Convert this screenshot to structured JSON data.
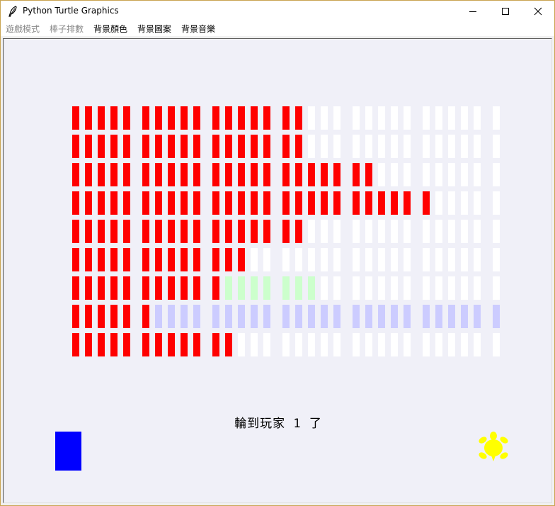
{
  "window": {
    "title": "Python Turtle Graphics",
    "icon": "feather-icon",
    "minimize": "minimize-icon",
    "maximize": "maximize-icon",
    "close": "close-icon"
  },
  "menu": [
    {
      "label": "遊戲模式",
      "enabled": false
    },
    {
      "label": "棒子排數",
      "enabled": false
    },
    {
      "label": "背景顏色",
      "enabled": true
    },
    {
      "label": "背景圖案",
      "enabled": true
    },
    {
      "label": "背景音樂",
      "enabled": true
    }
  ],
  "board": {
    "rows": [
      "RRRRR RRRRR RRRRR RRWWW WWWWW WWWWW W",
      "RRRRR RRRRR RRRRR RRWWW WWWWW WWWWW W",
      "RRRRR RRRRR RRRRR RRRRR RRWWW WWWWW W",
      "RRRRR RRRRR RRRRR RRRRR RRRRR RWWWW W",
      "RRRRR RRRRR RRRRR RRWWW WWWWW WWWWW W",
      "RRRRR RRRRR RRRWW WWWWW WWWWW WWWWW W",
      "RRRRR RRRRR RGGGG GGGWW WWWWW WWWWW W",
      "RRRRR RBBBB BBBBB BBBBB BBBBB BBBBB B",
      "RRRRR RRRRR RRWWW WWWWW WWWWW WWWWW W"
    ],
    "colors": {
      "R": "#ff0000",
      "W": "#ffffff",
      "G": "#ccffcc",
      "B": "#ccccff",
      "background": "#f0f0f8"
    }
  },
  "status": "輪到玩家 1 了",
  "player_stick_color": "#0000ff",
  "turtle_color": "#ffff00"
}
